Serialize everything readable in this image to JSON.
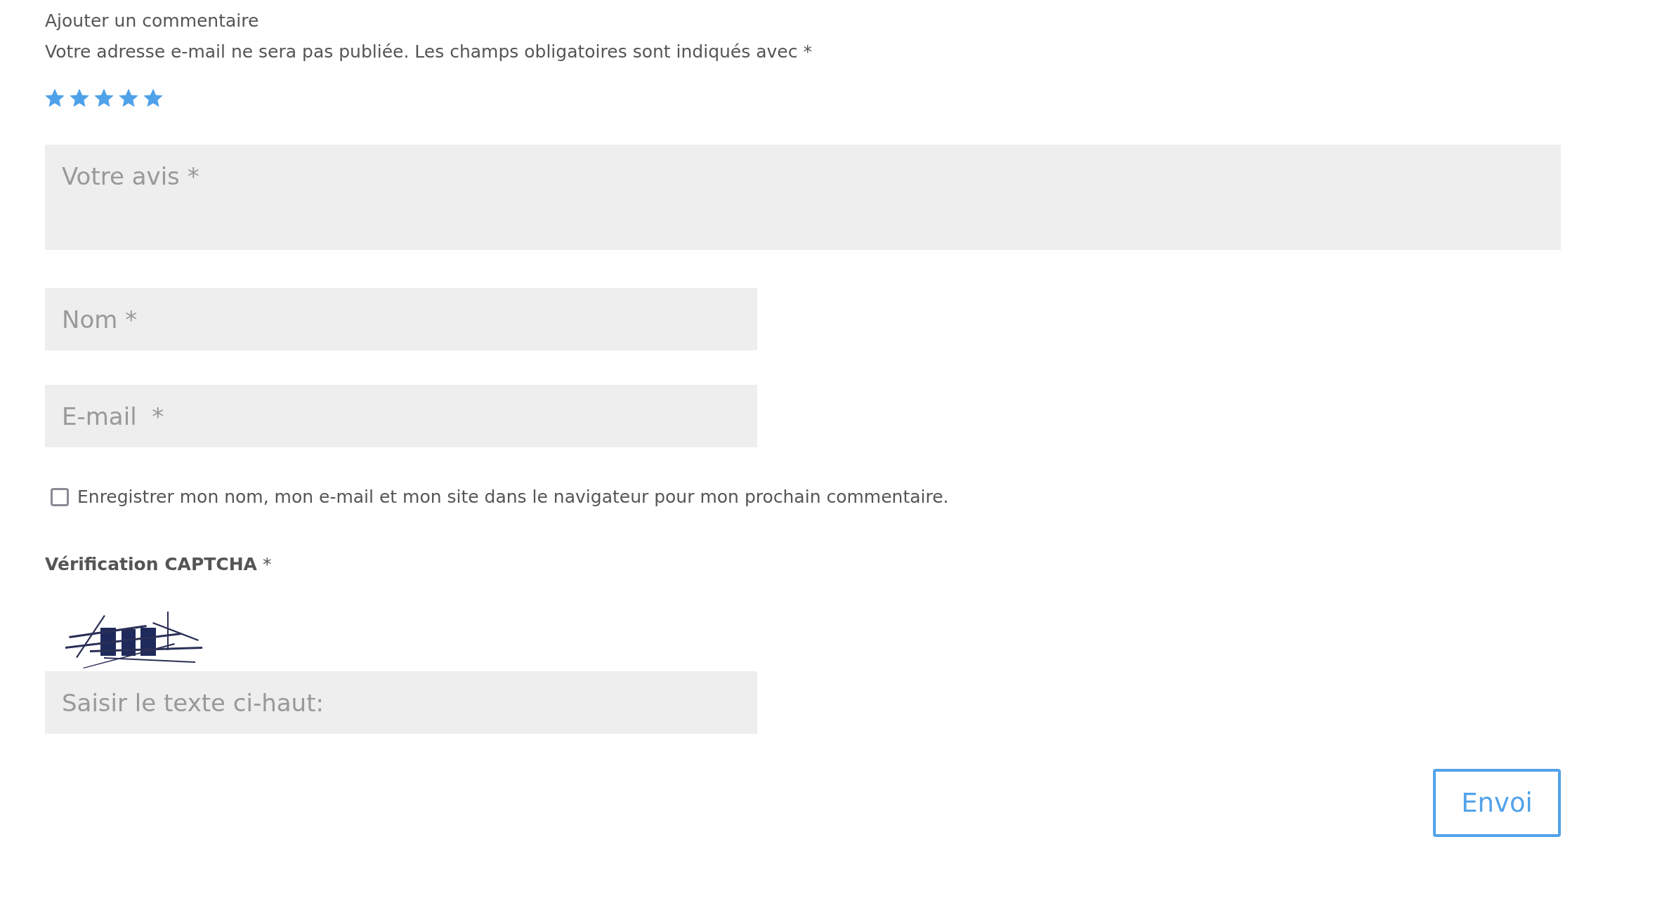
{
  "heading": "Ajouter un commentaire",
  "note": "Votre adresse e-mail ne sera pas publiée. Les champs obligatoires sont indiqués avec *",
  "rating": {
    "stars": 5
  },
  "review": {
    "placeholder": "Votre avis *"
  },
  "name": {
    "placeholder": "Nom *"
  },
  "email": {
    "placeholder": "E-mail  *"
  },
  "remember": {
    "label": "Enregistrer mon nom, mon e-mail et mon site dans le navigateur pour mon prochain commentaire.",
    "checked": false
  },
  "captcha": {
    "label": "Vérification CAPTCHA",
    "required_mark": "*",
    "placeholder": "Saisir le texte ci-haut:"
  },
  "submit": "Envoi"
}
